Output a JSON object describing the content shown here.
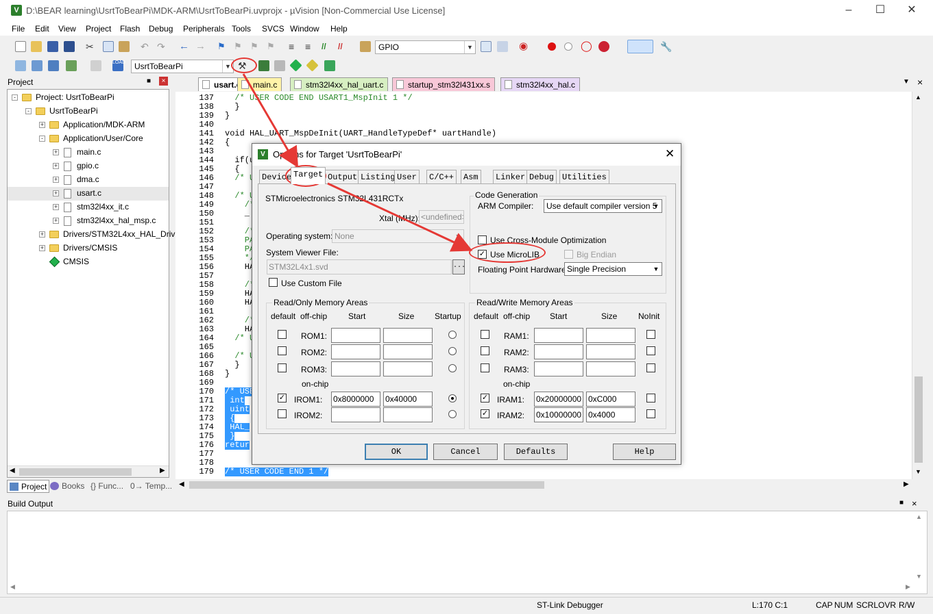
{
  "window": {
    "title": "D:\\BEAR learning\\UsrtToBearPi\\MDK-ARM\\UsrtToBearPi.uvprojx - µVision  [Non-Commercial Use License]",
    "app_icon": "V"
  },
  "menu": [
    "File",
    "Edit",
    "View",
    "Project",
    "Flash",
    "Debug",
    "Peripherals",
    "Tools",
    "SVCS",
    "Window",
    "Help"
  ],
  "toolbar": {
    "find_combo": "GPIO",
    "target_combo": "UsrtToBearPi"
  },
  "project_panel": {
    "title": "Project",
    "tree": [
      {
        "label": "Project: UsrtToBearPi",
        "indent": 0,
        "kind": "root",
        "exp": "-"
      },
      {
        "label": "UsrtToBearPi",
        "indent": 1,
        "kind": "folder",
        "exp": "-"
      },
      {
        "label": "Application/MDK-ARM",
        "indent": 2,
        "kind": "folder",
        "exp": "+"
      },
      {
        "label": "Application/User/Core",
        "indent": 2,
        "kind": "folder",
        "exp": "-"
      },
      {
        "label": "main.c",
        "indent": 3,
        "kind": "file",
        "exp": "+"
      },
      {
        "label": "gpio.c",
        "indent": 3,
        "kind": "file",
        "exp": "+"
      },
      {
        "label": "dma.c",
        "indent": 3,
        "kind": "file",
        "exp": "+"
      },
      {
        "label": "usart.c",
        "indent": 3,
        "kind": "file",
        "exp": "+"
      },
      {
        "label": "stm32l4xx_it.c",
        "indent": 3,
        "kind": "file",
        "exp": "+"
      },
      {
        "label": "stm32l4xx_hal_msp.c",
        "indent": 3,
        "kind": "file",
        "exp": "+"
      },
      {
        "label": "Drivers/STM32L4xx_HAL_Driv",
        "indent": 2,
        "kind": "folder",
        "exp": "+"
      },
      {
        "label": "Drivers/CMSIS",
        "indent": 2,
        "kind": "folder",
        "exp": "+"
      },
      {
        "label": "CMSIS",
        "indent": 2,
        "kind": "diamond",
        "exp": ""
      }
    ],
    "bottom_tabs": [
      "Project",
      "Books",
      "{} Func...",
      "0→ Temp..."
    ]
  },
  "editor": {
    "tabs": [
      {
        "label": "usart.c",
        "color": "#ffffff",
        "active": true
      },
      {
        "label": "main.c",
        "color": "#fff3a8",
        "active": false
      },
      {
        "label": "stm32l4xx_hal_uart.c",
        "color": "#d7efc2",
        "active": false
      },
      {
        "label": "startup_stm32l431xx.s",
        "color": "#f8c8d8",
        "active": false
      },
      {
        "label": "stm32l4xx_hal.c",
        "color": "#e6d7f5",
        "active": false
      }
    ],
    "line_numbers": [
      "137",
      "138",
      "139",
      "140",
      "141",
      "142",
      "143",
      "144",
      "145",
      "146",
      "147",
      "148",
      "149",
      "150",
      "151",
      "152",
      "153",
      "154",
      "155",
      "156",
      "157",
      "158",
      "159",
      "160",
      "161",
      "162",
      "163",
      "164",
      "165",
      "166",
      "167",
      "168",
      "169",
      "170",
      "171",
      "172",
      "173",
      "174",
      "175",
      "176",
      "177",
      "178",
      "179"
    ],
    "code_lines": [
      {
        "t": "  /* USER CODE END USART1_MspInit 1 */",
        "c": "cm"
      },
      {
        "t": "  }",
        "c": ""
      },
      {
        "t": "}",
        "c": ""
      },
      {
        "t": "",
        "c": ""
      },
      {
        "t": "void HAL_UART_MspDeInit(UART_HandleTypeDef* uartHandle)",
        "c": ""
      },
      {
        "t": "{",
        "c": ""
      },
      {
        "t": "",
        "c": ""
      },
      {
        "t": "  if(u",
        "c": ""
      },
      {
        "t": "  {",
        "c": ""
      },
      {
        "t": "  /* U",
        "c": "cm"
      },
      {
        "t": "",
        "c": ""
      },
      {
        "t": "  /* U",
        "c": "cm"
      },
      {
        "t": "    /*",
        "c": "cm"
      },
      {
        "t": "    _",
        "c": ""
      },
      {
        "t": "",
        "c": ""
      },
      {
        "t": "    /*",
        "c": "cm"
      },
      {
        "t": "    PA",
        "c": "cm"
      },
      {
        "t": "    PA",
        "c": "cm"
      },
      {
        "t": "    */",
        "c": "cm"
      },
      {
        "t": "    HA",
        "c": ""
      },
      {
        "t": "",
        "c": ""
      },
      {
        "t": "    /*",
        "c": "cm"
      },
      {
        "t": "    HA",
        "c": ""
      },
      {
        "t": "    HA",
        "c": ""
      },
      {
        "t": "",
        "c": ""
      },
      {
        "t": "    /*",
        "c": "cm"
      },
      {
        "t": "    HA",
        "c": ""
      },
      {
        "t": "  /* U",
        "c": "cm"
      },
      {
        "t": "",
        "c": ""
      },
      {
        "t": "  /* U",
        "c": "cm"
      },
      {
        "t": "  }",
        "c": ""
      },
      {
        "t": "}",
        "c": ""
      },
      {
        "t": "",
        "c": ""
      },
      {
        "t": "/* USE",
        "c": "sel"
      },
      {
        "t": " int",
        "c": "sel"
      },
      {
        "t": " uint",
        "c": "sel"
      },
      {
        "t": " {",
        "c": "sel"
      },
      {
        "t": " HAL_",
        "c": "sel"
      },
      {
        "t": " }",
        "c": "sel"
      },
      {
        "t": "retur",
        "c": "sel"
      },
      {
        "t": "",
        "c": ""
      },
      {
        "t": "",
        "c": ""
      },
      {
        "t": "/* USER CODE END 1 */",
        "c": "sel"
      }
    ]
  },
  "build_output": {
    "title": "Build Output"
  },
  "status": {
    "debugger": "ST-Link Debugger",
    "position": "L:170 C:1",
    "caps": "CAP",
    "num": "NUM",
    "scrl": "SCRL",
    "ovr": "OVR",
    "rw": "R/W"
  },
  "dialog": {
    "title": "Options for Target 'UsrtToBearPi'",
    "tabs": [
      "Device",
      "Target",
      "Output",
      "Listing",
      "User",
      "C/C++",
      "Asm",
      "Linker",
      "Debug",
      "Utilities"
    ],
    "active_tab": "Target",
    "device": "STMicroelectronics STM32L431RCTx",
    "xtal_label": "Xtal (MHz):",
    "xtal_value": "<undefined>",
    "os_label": "Operating system:",
    "os_value": "None",
    "svd_label": "System Viewer File:",
    "svd_value": "STM32L4x1.svd",
    "svd_browse": "...",
    "custom_file_label": "Use Custom File",
    "codegen": {
      "title": "Code Generation",
      "compiler_label": "ARM Compiler:",
      "compiler_value": "Use default compiler version 5",
      "cross_module": "Use Cross-Module Optimization",
      "microlib": "Use MicroLIB",
      "big_endian": "Big Endian",
      "fpu_label": "Floating Point Hardware:",
      "fpu_value": "Single Precision"
    },
    "ro_mem": {
      "title": "Read/Only Memory Areas",
      "headers": [
        "default",
        "off-chip",
        "Start",
        "Size",
        "Startup"
      ],
      "on_chip": "on-chip",
      "rows": [
        {
          "label": "ROM1:",
          "start": "",
          "size": "",
          "default": false,
          "startup": false
        },
        {
          "label": "ROM2:",
          "start": "",
          "size": "",
          "default": false,
          "startup": false
        },
        {
          "label": "ROM3:",
          "start": "",
          "size": "",
          "default": false,
          "startup": false
        },
        {
          "label": "IROM1:",
          "start": "0x8000000",
          "size": "0x40000",
          "default": true,
          "startup": true
        },
        {
          "label": "IROM2:",
          "start": "",
          "size": "",
          "default": false,
          "startup": false
        }
      ]
    },
    "rw_mem": {
      "title": "Read/Write Memory Areas",
      "headers": [
        "default",
        "off-chip",
        "Start",
        "Size",
        "NoInit"
      ],
      "on_chip": "on-chip",
      "rows": [
        {
          "label": "RAM1:",
          "start": "",
          "size": "",
          "default": false
        },
        {
          "label": "RAM2:",
          "start": "",
          "size": "",
          "default": false
        },
        {
          "label": "RAM3:",
          "start": "",
          "size": "",
          "default": false
        },
        {
          "label": "IRAM1:",
          "start": "0x20000000",
          "size": "0xC000",
          "default": true
        },
        {
          "label": "IRAM2:",
          "start": "0x10000000",
          "size": "0x4000",
          "default": true
        }
      ]
    },
    "buttons": {
      "ok": "OK",
      "cancel": "Cancel",
      "defaults": "Defaults",
      "help": "Help"
    }
  },
  "colors": {
    "annotation": "#e53935",
    "selection": "#3399ff",
    "comment": "#2b8a2b"
  }
}
